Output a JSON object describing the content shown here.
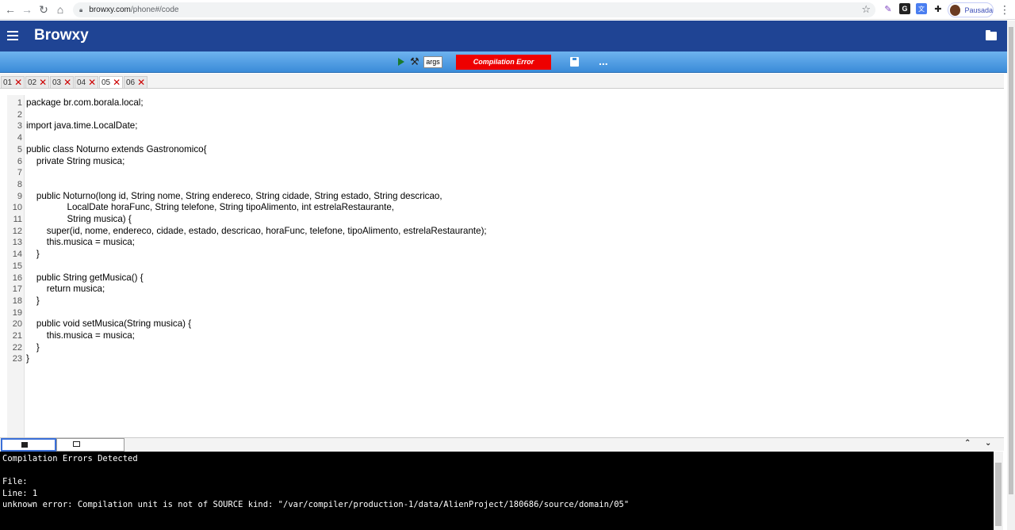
{
  "browser": {
    "url_host": "browxy.com",
    "url_path": "/phone#/code",
    "profile_label": "Pausada"
  },
  "app": {
    "title": "Browxy"
  },
  "toolbar": {
    "args_label": "args",
    "status": "Compilation Error",
    "more": "...",
    "status_color": "#ee0000"
  },
  "tabs": [
    {
      "label": "01",
      "close": "✕"
    },
    {
      "label": "02",
      "close": "✕"
    },
    {
      "label": "03",
      "close": "✕"
    },
    {
      "label": "04",
      "close": "✕"
    },
    {
      "label": "05",
      "close": "✕"
    },
    {
      "label": "06",
      "close": "✕"
    }
  ],
  "editor": {
    "lines": [
      "package br.com.borala.local;",
      "",
      "import java.time.LocalDate;",
      "",
      "public class Noturno extends Gastronomico{",
      "    private String musica;",
      "",
      "",
      "    public Noturno(long id, String nome, String endereco, String cidade, String estado, String descricao,",
      "                LocalDate horaFunc, String telefone, String tipoAlimento, int estrelaRestaurante,",
      "                String musica) {",
      "        super(id, nome, endereco, cidade, estado, descricao, horaFunc, telefone, tipoAlimento, estrelaRestaurante);",
      "        this.musica = musica;",
      "    }",
      "",
      "    public String getMusica() {",
      "        return musica;",
      "    }",
      "",
      "    public void setMusica(String musica) {",
      "        this.musica = musica;",
      "    }",
      "}"
    ],
    "line_numbers": [
      "1",
      "2",
      "3",
      "4",
      "5",
      "6",
      "7",
      "8",
      "9",
      "10",
      "11",
      "12",
      "13",
      "14",
      "15",
      "16",
      "17",
      "18",
      "19",
      "20",
      "21",
      "22",
      "23"
    ]
  },
  "console": {
    "lines": [
      "Compilation Errors Detected",
      "",
      "File:",
      "Line: 1",
      "unknown error: Compilation unit is not of SOURCE kind: \"/var/compiler/production-1/data/AlienProject/180686/source/domain/05\""
    ],
    "arrow_up": "⌃",
    "arrow_down": "⌄"
  }
}
